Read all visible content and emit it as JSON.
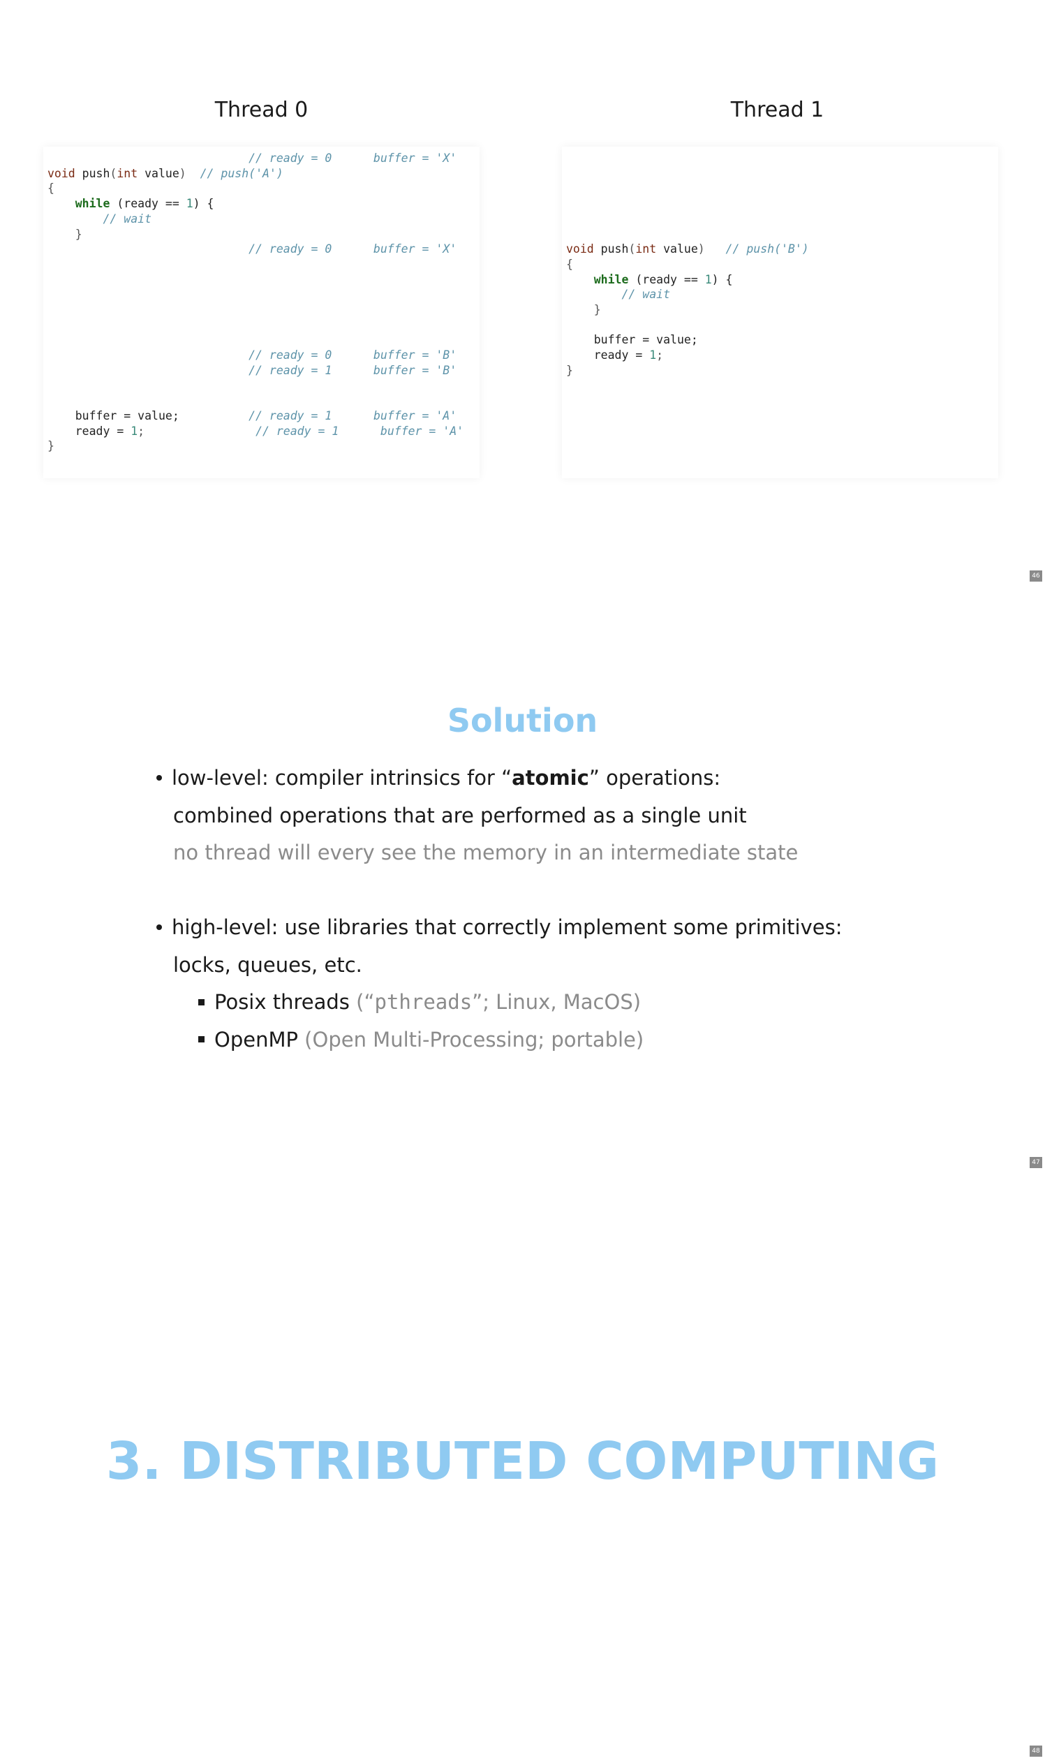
{
  "slide1": {
    "thread0_title": "Thread 0",
    "thread1_title": "Thread 1",
    "page_number": "46",
    "t0": {
      "l1_c1": "// ready = 0",
      "l1_c2": "buffer = 'X'",
      "l2_type": "void",
      "l2_name": " push",
      "l2_paren1": "(",
      "l2_int": "int",
      "l2_val": " value",
      "l2_paren2": ")",
      "l2_cm": "// push('A')",
      "l3": "{",
      "l4_while": "while",
      "l4_a": " (ready == ",
      "l4_num": "1",
      "l4_b": ") {",
      "l5_cm": "// wait",
      "l6": "}",
      "l7_c1": "// ready = 0",
      "l7_c2": "buffer = 'X'",
      "l8_c1": "// ready = 0",
      "l8_c2": "buffer = 'B'",
      "l9_c1": "// ready = 1",
      "l9_c2": "buffer = 'B'",
      "l10_code": "buffer = value;",
      "l10_c1": "// ready = 1",
      "l10_c2": "buffer = 'A'",
      "l11_a": "ready = ",
      "l11_num": "1",
      "l11_b": ";",
      "l11_c1": "// ready = 1",
      "l11_c2": "buffer = 'A'",
      "l12": "}"
    },
    "t1": {
      "l1_type": "void",
      "l1_name": " push",
      "l1_paren1": "(",
      "l1_int": "int",
      "l1_val": " value",
      "l1_paren2": ")",
      "l1_cm": "// push('B')",
      "l2": "{",
      "l3_while": "while",
      "l3_a": " (ready == ",
      "l3_num": "1",
      "l3_b": ") {",
      "l4_cm": "// wait",
      "l5": "}",
      "l6": "buffer = value;",
      "l7_a": "ready = ",
      "l7_num": "1",
      "l7_b": ";",
      "l8": "}"
    }
  },
  "slide2": {
    "title": "Solution",
    "page_number": "47",
    "b1_pre": "low-level: compiler intrinsics for “",
    "b1_bold": "atomic",
    "b1_post": "” operations:",
    "b1_line2": "combined operations that are performed as a single unit",
    "b1_line3": "no thread will every see the memory in an intermediate state",
    "b2_line1": "high-level: use libraries that correctly implement some primitives:",
    "b2_line2": "locks, queues, etc.",
    "s1_main": "Posix threads",
    "s1_g1": " (“",
    "s1_mono": "pthreads",
    "s1_g2": "”; Linux, MacOS)",
    "s2_main": "OpenMP",
    "s2_grey": " (Open Multi-Processing; portable)"
  },
  "slide3": {
    "title": "3. DISTRIBUTED COMPUTING",
    "page_number": "48"
  }
}
